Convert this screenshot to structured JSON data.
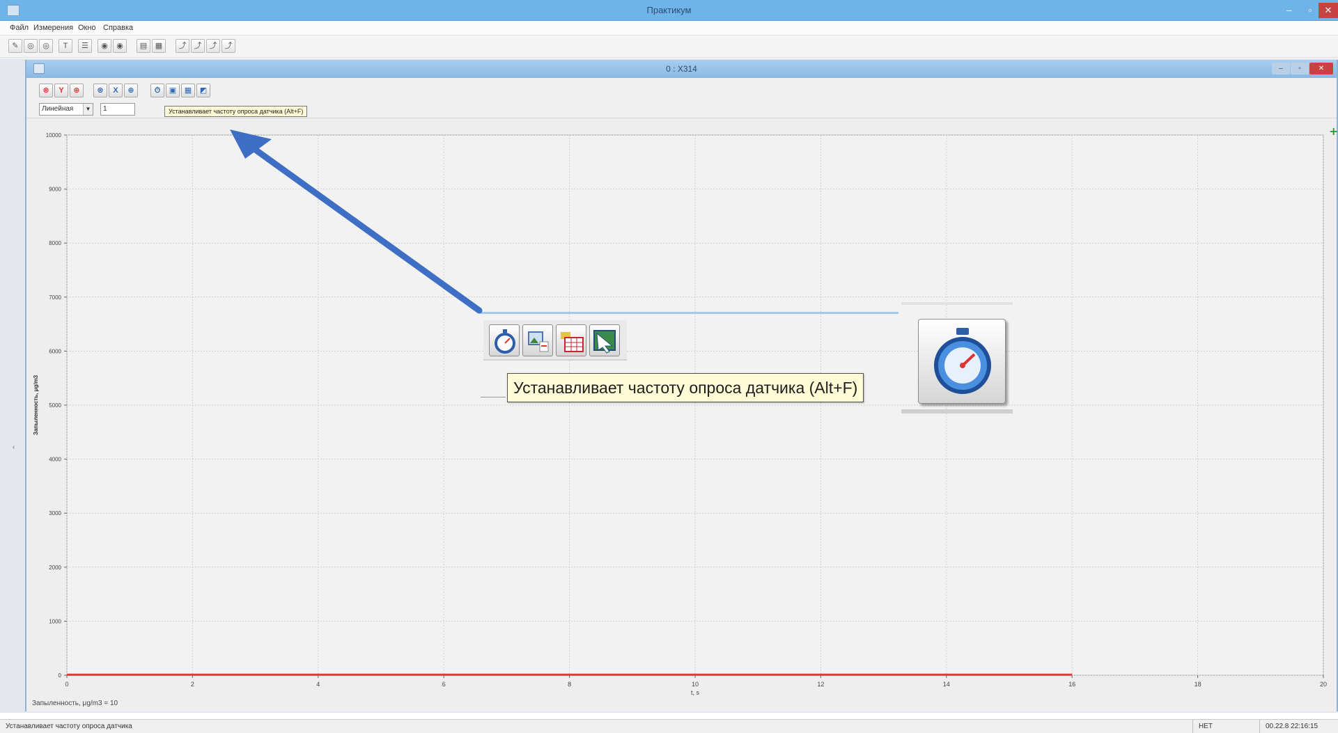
{
  "app": {
    "title": "Практикум",
    "menu": [
      "Файл",
      "Измерения",
      "Окно",
      "Справка"
    ],
    "window_buttons": {
      "minimize": "–",
      "maximize": "▫",
      "close": "✕"
    },
    "toolbar_buttons": [
      "✎",
      "◎",
      "◎",
      "T",
      "☰",
      "◉",
      "◉",
      "▤",
      "▦",
      "⤴",
      "⤴",
      "⤴",
      "⤴"
    ]
  },
  "child": {
    "title": "0 : Х314",
    "window_buttons": {
      "minimize": "–",
      "maximize": "▫",
      "close": "✕"
    },
    "toolbar": {
      "buttons": [
        {
          "glyph": "⊗",
          "icon": "y-zoom-out-icon",
          "color": "red"
        },
        {
          "glyph": "Y",
          "icon": "y-axis-icon",
          "color": "red"
        },
        {
          "glyph": "⊕",
          "icon": "y-zoom-in-icon",
          "color": "red"
        },
        {
          "glyph": "⊗",
          "icon": "x-zoom-out-icon",
          "color": "blue"
        },
        {
          "glyph": "X",
          "icon": "x-axis-icon",
          "color": "blue"
        },
        {
          "glyph": "⊕",
          "icon": "x-zoom-in-icon",
          "color": "blue"
        },
        {
          "glyph": "⏱",
          "icon": "stopwatch-icon",
          "color": "blue"
        },
        {
          "glyph": "▣",
          "icon": "image-export-icon",
          "color": "blue"
        },
        {
          "glyph": "▦",
          "icon": "table-icon",
          "color": "blue"
        },
        {
          "glyph": "◩",
          "icon": "chart-export-icon",
          "color": "blue"
        }
      ],
      "scale_select": "Линейная",
      "value_input": "1"
    },
    "small_tooltip": "Устанавливает частоту опроса датчика (Alt+F)",
    "footer_text": "Запыленность, μg/m3 = 10"
  },
  "callout": {
    "tooltip": "Устанавливает частоту опроса датчика (Alt+F)"
  },
  "status": {
    "text": "Устанавливает частоту опроса датчика",
    "mode": "НЕТ",
    "date": "00.22.8   22:16:15"
  },
  "colors": {
    "series": "#d93a3a",
    "arrow": "#3f6fc4",
    "titlebar": "#6fb4e9"
  },
  "chart_data": {
    "type": "line",
    "title": "",
    "xlabel": "t, s",
    "ylabel": "Запыленность, μg/m3",
    "xlim": [
      0,
      20
    ],
    "ylim": [
      0,
      10000
    ],
    "x_ticks": [
      0,
      2,
      4,
      6,
      8,
      10,
      12,
      14,
      16,
      18,
      20
    ],
    "y_ticks": [
      0,
      1000,
      2000,
      3000,
      4000,
      5000,
      6000,
      7000,
      8000,
      9000,
      10000
    ],
    "grid": true,
    "series": [
      {
        "x": [
          0,
          16
        ],
        "y": [
          10,
          10
        ]
      }
    ]
  }
}
